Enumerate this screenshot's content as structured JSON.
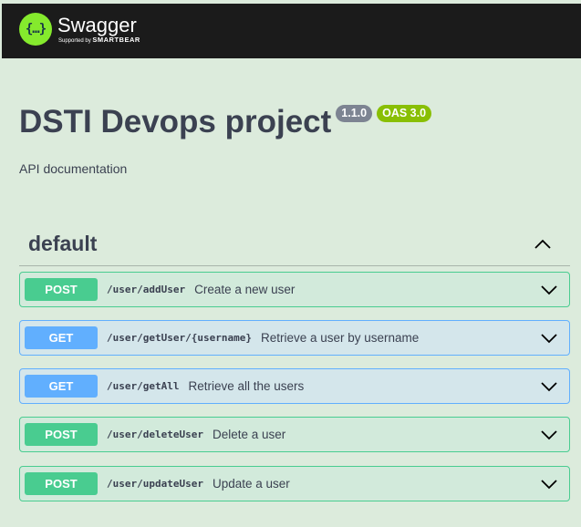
{
  "header": {
    "logo_glyph": "{…}",
    "brand_name": "Swagger",
    "supported_by": "Supported by",
    "supporter": "SMARTBEAR"
  },
  "info": {
    "title": "DSTI Devops project",
    "version": "1.1.0",
    "oas": "OAS 3.0",
    "description": "API documentation"
  },
  "tag": {
    "name": "default",
    "expanded": true,
    "toggle_icon": "chevron-up-icon"
  },
  "operations": [
    {
      "method": "POST",
      "path": "/user/addUser",
      "summary": "Create a new user"
    },
    {
      "method": "GET",
      "path": "/user/getUser/{username}",
      "summary": "Retrieve a user by username"
    },
    {
      "method": "GET",
      "path": "/user/getAll",
      "summary": "Retrieve all the users"
    },
    {
      "method": "POST",
      "path": "/user/deleteUser",
      "summary": "Delete a user"
    },
    {
      "method": "POST",
      "path": "/user/updateUser",
      "summary": "Update a user"
    }
  ],
  "colors": {
    "page_background": "#dcebdc",
    "topbar": "#1b1b1b",
    "logo": "#85ea2d",
    "post": "#49cc90",
    "get": "#61affe",
    "version_badge": "#7d8492",
    "oas_badge": "#89bf04"
  }
}
